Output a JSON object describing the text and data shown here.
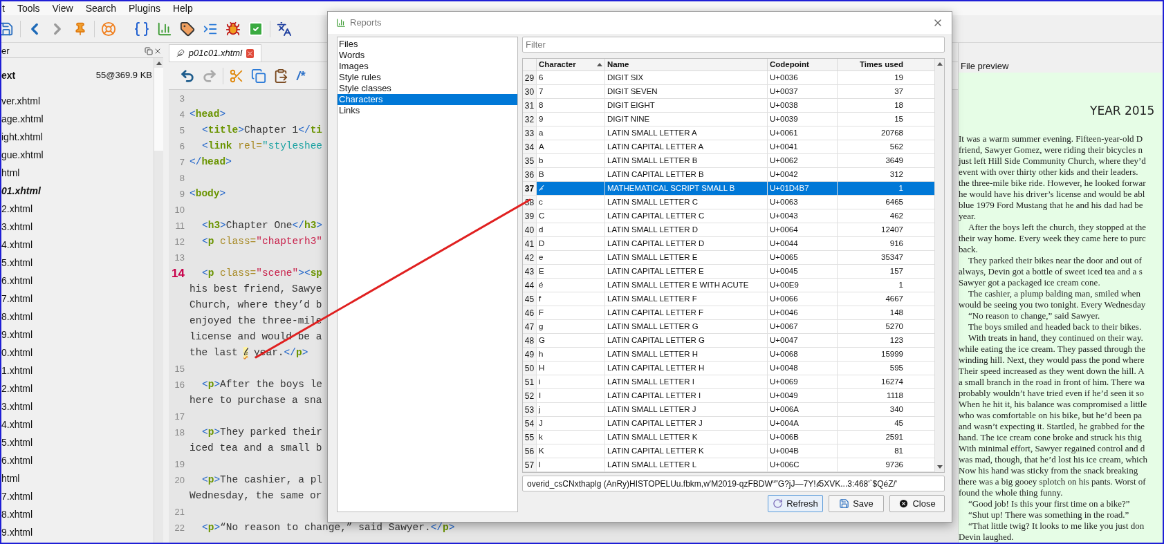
{
  "menu_bar": [
    "t",
    "Tools",
    "View",
    "Search",
    "Plugins",
    "Help"
  ],
  "book_browser": {
    "title": "er",
    "folder": {
      "name": "ext",
      "size": "55@369.9 KB"
    },
    "files": [
      {
        "name": "ver.xhtml",
        "open": false
      },
      {
        "name": "age.xhtml",
        "open": false
      },
      {
        "name": "ight.xhtml",
        "open": false
      },
      {
        "name": "gue.xhtml",
        "open": false
      },
      {
        "name": "html",
        "open": false
      },
      {
        "name": "01.xhtml",
        "open": true
      },
      {
        "name": "2.xhtml",
        "open": false
      },
      {
        "name": "3.xhtml",
        "open": false
      },
      {
        "name": "4.xhtml",
        "open": false
      },
      {
        "name": "5.xhtml",
        "open": false
      },
      {
        "name": "6.xhtml",
        "open": false
      },
      {
        "name": "7.xhtml",
        "open": false
      },
      {
        "name": "8.xhtml",
        "open": false
      },
      {
        "name": "9.xhtml",
        "open": false
      },
      {
        "name": "0.xhtml",
        "open": false
      },
      {
        "name": "1.xhtml",
        "open": false
      },
      {
        "name": "2.xhtml",
        "open": false
      },
      {
        "name": "3.xhtml",
        "open": false
      },
      {
        "name": "4.xhtml",
        "open": false
      },
      {
        "name": "5.xhtml",
        "open": false
      },
      {
        "name": "6.xhtml",
        "open": false
      },
      {
        "name": "html",
        "open": false
      },
      {
        "name": "7.xhtml",
        "open": false
      },
      {
        "name": "8.xhtml",
        "open": false
      },
      {
        "name": "9.xhtml",
        "open": false
      }
    ]
  },
  "editor": {
    "tab": {
      "label": "p01c01.xhtml",
      "selected": true
    },
    "comment_button": "/*",
    "code_lines": [
      {
        "number": "3",
        "current": false
      },
      {
        "number": "4",
        "current": false,
        "indent": false,
        "segments": [
          {
            "kind": "punct",
            "text": "<"
          },
          {
            "kind": "tag",
            "text": "head"
          },
          {
            "kind": "punct",
            "text": ">"
          }
        ]
      },
      {
        "number": "5",
        "current": false,
        "indent": true,
        "segments": [
          {
            "kind": "punct",
            "text": "<"
          },
          {
            "kind": "tag",
            "text": "title"
          },
          {
            "kind": "punct",
            "text": ">"
          },
          {
            "kind": "text",
            "text": "Chapter 1"
          },
          {
            "kind": "punct",
            "text": "</"
          },
          {
            "kind": "tag",
            "text": "ti"
          }
        ]
      },
      {
        "number": "6",
        "current": false,
        "indent": true,
        "segments": [
          {
            "kind": "punct",
            "text": "<"
          },
          {
            "kind": "tag",
            "text": "link"
          },
          {
            "kind": "attr",
            "text": " rel="
          },
          {
            "kind": "value-alt",
            "text": "\"styleshee"
          }
        ]
      },
      {
        "number": "7",
        "current": false,
        "indent": false,
        "segments": [
          {
            "kind": "punct",
            "text": "</"
          },
          {
            "kind": "tag",
            "text": "head"
          },
          {
            "kind": "punct",
            "text": ">"
          }
        ]
      },
      {
        "number": "8",
        "current": false
      },
      {
        "number": "9",
        "current": false,
        "indent": false,
        "segments": [
          {
            "kind": "punct",
            "text": "<"
          },
          {
            "kind": "tag",
            "text": "body"
          },
          {
            "kind": "punct",
            "text": ">"
          }
        ]
      },
      {
        "number": "10",
        "current": false
      },
      {
        "number": "11",
        "current": false,
        "indent": true,
        "segments": [
          {
            "kind": "punct",
            "text": "<"
          },
          {
            "kind": "tag",
            "text": "h3"
          },
          {
            "kind": "punct",
            "text": ">"
          },
          {
            "kind": "text",
            "text": "Chapter One"
          },
          {
            "kind": "punct",
            "text": "</"
          },
          {
            "kind": "tag",
            "text": "h3"
          },
          {
            "kind": "punct",
            "text": ">"
          }
        ]
      },
      {
        "number": "12",
        "current": false,
        "indent": true,
        "segments": [
          {
            "kind": "punct",
            "text": "<"
          },
          {
            "kind": "tag",
            "text": "p"
          },
          {
            "kind": "attr",
            "text": " class="
          },
          {
            "kind": "value",
            "text": "\"chapterh3\""
          }
        ]
      },
      {
        "number": "13",
        "current": false
      },
      {
        "number": "14",
        "current": true,
        "indent": true,
        "segments": [
          {
            "kind": "punct",
            "text": "<"
          },
          {
            "kind": "tag",
            "text": "p"
          },
          {
            "kind": "attr",
            "text": " class="
          },
          {
            "kind": "value",
            "text": "\"scene\""
          },
          {
            "kind": "punct",
            "text": "><"
          },
          {
            "kind": "tag",
            "text": "sp"
          }
        ],
        "wrapped": [
          [
            {
              "kind": "text",
              "text": "his best friend, Sawye"
            }
          ],
          [
            {
              "kind": "text",
              "text": "Church, where they’d b"
            }
          ],
          [
            {
              "kind": "text",
              "text": "enjoyed the three-mile"
            }
          ],
          [
            {
              "kind": "text",
              "text": "license and would be a"
            }
          ],
          [
            {
              "kind": "text",
              "text": "the last "
            },
            {
              "kind": "highlight",
              "text": "𝒷"
            },
            {
              "kind": "text",
              "text": " year."
            },
            {
              "kind": "punct",
              "text": "</"
            },
            {
              "kind": "tag",
              "text": "p"
            },
            {
              "kind": "punct",
              "text": ">"
            }
          ]
        ]
      },
      {
        "number": "15",
        "current": false
      },
      {
        "number": "16",
        "current": false,
        "indent": true,
        "segments": [
          {
            "kind": "punct",
            "text": "<"
          },
          {
            "kind": "tag",
            "text": "p"
          },
          {
            "kind": "punct",
            "text": ">"
          },
          {
            "kind": "text",
            "text": "After the boys le"
          }
        ],
        "wrapped": [
          [
            {
              "kind": "text",
              "text": "here to purchase a sna"
            }
          ]
        ]
      },
      {
        "number": "17",
        "current": false
      },
      {
        "number": "18",
        "current": false,
        "indent": true,
        "segments": [
          {
            "kind": "punct",
            "text": "<"
          },
          {
            "kind": "tag",
            "text": "p"
          },
          {
            "kind": "punct",
            "text": ">"
          },
          {
            "kind": "text",
            "text": "They parked their"
          }
        ],
        "wrapped": [
          [
            {
              "kind": "text",
              "text": "iced tea and a small b"
            }
          ]
        ]
      },
      {
        "number": "19",
        "current": false
      },
      {
        "number": "20",
        "current": false,
        "indent": true,
        "segments": [
          {
            "kind": "punct",
            "text": "<"
          },
          {
            "kind": "tag",
            "text": "p"
          },
          {
            "kind": "punct",
            "text": ">"
          },
          {
            "kind": "text",
            "text": "The cashier, a pl"
          }
        ],
        "wrapped": [
          [
            {
              "kind": "text",
              "text": "Wednesday, the same or"
            }
          ]
        ]
      },
      {
        "number": "21",
        "current": false
      },
      {
        "number": "22",
        "current": false,
        "indent": true,
        "segments": [
          {
            "kind": "punct",
            "text": "<"
          },
          {
            "kind": "tag",
            "text": "p"
          },
          {
            "kind": "punct",
            "text": ">"
          },
          {
            "kind": "text",
            "text": "“No reason to change,” said Sawyer."
          },
          {
            "kind": "punct",
            "text": "</"
          },
          {
            "kind": "tag",
            "text": "p"
          },
          {
            "kind": "punct",
            "text": ">"
          }
        ]
      }
    ]
  },
  "reports_dialog": {
    "title": "Reports",
    "sections": [
      {
        "label": "Files",
        "selected": false
      },
      {
        "label": "Words",
        "selected": false
      },
      {
        "label": "Images",
        "selected": false
      },
      {
        "label": "Style rules",
        "selected": false
      },
      {
        "label": "Style classes",
        "selected": false
      },
      {
        "label": "Characters",
        "selected": true
      },
      {
        "label": "Links",
        "selected": false
      }
    ],
    "filter": {
      "placeholder": "Filter"
    },
    "table": {
      "columns": [
        {
          "label": "Character",
          "sorted": true
        },
        {
          "label": "Name",
          "sorted": false
        },
        {
          "label": "Codepoint",
          "sorted": false
        },
        {
          "label": "Times used",
          "sorted": false
        }
      ],
      "rows": [
        {
          "index": "29",
          "character": "6",
          "name": "DIGIT SIX",
          "codepoint": "U+0036",
          "times_used": "19",
          "selected": false
        },
        {
          "index": "30",
          "character": "7",
          "name": "DIGIT SEVEN",
          "codepoint": "U+0037",
          "times_used": "37",
          "selected": false
        },
        {
          "index": "31",
          "character": "8",
          "name": "DIGIT EIGHT",
          "codepoint": "U+0038",
          "times_used": "18",
          "selected": false
        },
        {
          "index": "32",
          "character": "9",
          "name": "DIGIT NINE",
          "codepoint": "U+0039",
          "times_used": "15",
          "selected": false
        },
        {
          "index": "33",
          "character": "a",
          "name": "LATIN SMALL LETTER A",
          "codepoint": "U+0061",
          "times_used": "20768",
          "selected": false
        },
        {
          "index": "34",
          "character": "A",
          "name": "LATIN CAPITAL LETTER A",
          "codepoint": "U+0041",
          "times_used": "562",
          "selected": false
        },
        {
          "index": "35",
          "character": "b",
          "name": "LATIN SMALL LETTER B",
          "codepoint": "U+0062",
          "times_used": "3649",
          "selected": false
        },
        {
          "index": "36",
          "character": "B",
          "name": "LATIN CAPITAL LETTER B",
          "codepoint": "U+0042",
          "times_used": "312",
          "selected": false
        },
        {
          "index": "37",
          "character": "𝒷",
          "name": "MATHEMATICAL SCRIPT SMALL B",
          "codepoint": "U+01D4B7",
          "times_used": "1",
          "selected": true
        },
        {
          "index": "38",
          "character": "c",
          "name": "LATIN SMALL LETTER C",
          "codepoint": "U+0063",
          "times_used": "6465",
          "selected": false
        },
        {
          "index": "39",
          "character": "C",
          "name": "LATIN CAPITAL LETTER C",
          "codepoint": "U+0043",
          "times_used": "462",
          "selected": false
        },
        {
          "index": "40",
          "character": "d",
          "name": "LATIN SMALL LETTER D",
          "codepoint": "U+0064",
          "times_used": "12407",
          "selected": false
        },
        {
          "index": "41",
          "character": "D",
          "name": "LATIN CAPITAL LETTER D",
          "codepoint": "U+0044",
          "times_used": "916",
          "selected": false
        },
        {
          "index": "42",
          "character": "e",
          "name": "LATIN SMALL LETTER E",
          "codepoint": "U+0065",
          "times_used": "35347",
          "selected": false
        },
        {
          "index": "43",
          "character": "E",
          "name": "LATIN CAPITAL LETTER E",
          "codepoint": "U+0045",
          "times_used": "157",
          "selected": false
        },
        {
          "index": "44",
          "character": "é",
          "name": "LATIN SMALL LETTER E WITH ACUTE",
          "codepoint": "U+00E9",
          "times_used": "1",
          "selected": false
        },
        {
          "index": "45",
          "character": "f",
          "name": "LATIN SMALL LETTER F",
          "codepoint": "U+0066",
          "times_used": "4667",
          "selected": false
        },
        {
          "index": "46",
          "character": "F",
          "name": "LATIN CAPITAL LETTER F",
          "codepoint": "U+0046",
          "times_used": "148",
          "selected": false
        },
        {
          "index": "47",
          "character": "g",
          "name": "LATIN SMALL LETTER G",
          "codepoint": "U+0067",
          "times_used": "5270",
          "selected": false
        },
        {
          "index": "48",
          "character": "G",
          "name": "LATIN CAPITAL LETTER G",
          "codepoint": "U+0047",
          "times_used": "123",
          "selected": false
        },
        {
          "index": "49",
          "character": "h",
          "name": "LATIN SMALL LETTER H",
          "codepoint": "U+0068",
          "times_used": "15999",
          "selected": false
        },
        {
          "index": "50",
          "character": "H",
          "name": "LATIN CAPITAL LETTER H",
          "codepoint": "U+0048",
          "times_used": "595",
          "selected": false
        },
        {
          "index": "51",
          "character": "i",
          "name": "LATIN SMALL LETTER I",
          "codepoint": "U+0069",
          "times_used": "16274",
          "selected": false
        },
        {
          "index": "52",
          "character": "I",
          "name": "LATIN CAPITAL LETTER I",
          "codepoint": "U+0049",
          "times_used": "1118",
          "selected": false
        },
        {
          "index": "53",
          "character": "j",
          "name": "LATIN SMALL LETTER J",
          "codepoint": "U+006A",
          "times_used": "340",
          "selected": false
        },
        {
          "index": "54",
          "character": "J",
          "name": "LATIN CAPITAL LETTER J",
          "codepoint": "U+004A",
          "times_used": "45",
          "selected": false
        },
        {
          "index": "55",
          "character": "k",
          "name": "LATIN SMALL LETTER K",
          "codepoint": "U+006B",
          "times_used": "2591",
          "selected": false
        },
        {
          "index": "56",
          "character": "K",
          "name": "LATIN CAPITAL LETTER K",
          "codepoint": "U+004B",
          "times_used": "81",
          "selected": false
        },
        {
          "index": "57",
          "character": "l",
          "name": "LATIN SMALL LETTER L",
          "codepoint": "U+006C",
          "times_used": "9736",
          "selected": false
        }
      ]
    },
    "detail_field": {
      "value": "overid_csCNxthaplg (AnRy)HISTOPELUu.fbkm,w'M2019-qzFBDW“”G?jJ—7Y!𝒷5XVK...3:468'`$QéZ/'"
    },
    "buttons": [
      {
        "kind": "refresh",
        "label": "Refresh"
      },
      {
        "kind": "save",
        "label": "Save"
      },
      {
        "kind": "close",
        "label": "Close"
      }
    ]
  },
  "file_preview": {
    "title": "File preview",
    "heading": "YEAR 2015",
    "lines": [
      {
        "text": "It was a warm summer evening. Fifteen-year-old D",
        "indent": false
      },
      {
        "text": "friend, Sawyer Gomez, were riding their bicycles n",
        "indent": false
      },
      {
        "text": "just left Hill Side Community Church, where they’d",
        "indent": false
      },
      {
        "text": "event with over thirty other kids and their leaders.",
        "indent": false
      },
      {
        "text": "the three-mile bike ride. However, he looked forwar",
        "indent": false
      },
      {
        "text": "he would have his driver’s license and would be abl",
        "indent": false
      },
      {
        "text": "blue 1979 Ford Mustang that he and his dad had be",
        "indent": false
      },
      {
        "text": "year.",
        "indent": false
      },
      {
        "text": "After the boys left the church, they stopped at the",
        "indent": true
      },
      {
        "text": "their way home. Every week they came here to purc",
        "indent": false
      },
      {
        "text": "back.",
        "indent": false
      },
      {
        "text": "They parked their bikes near the door and out of",
        "indent": true
      },
      {
        "text": "always, Devin got a bottle of sweet iced tea and a s",
        "indent": false
      },
      {
        "text": "Sawyer got a packaged ice cream cone.",
        "indent": false
      },
      {
        "text": "The cashier, a plump balding man, smiled when",
        "indent": true
      },
      {
        "text": "would be seeing you two tonight. Every Wednesday",
        "indent": false
      },
      {
        "text": "“No reason to change,” said Sawyer.",
        "indent": true
      },
      {
        "text": "The boys smiled and headed back to their bikes.",
        "indent": true
      },
      {
        "text": "With treats in hand, they continued on their way.",
        "indent": true
      },
      {
        "text": "while eating the ice cream. They passed through the",
        "indent": false
      },
      {
        "text": "winding hill. Next, they would pass the pond where",
        "indent": false
      },
      {
        "text": "Their speed increased as they went down the hill. A",
        "indent": false
      },
      {
        "text": "a small branch in the road in front of him. There wa",
        "indent": false
      },
      {
        "text": "probably wouldn’t have tried even if he’d seen it so",
        "indent": false
      },
      {
        "text": "When he hit it, his balance was compromised a little",
        "indent": false
      },
      {
        "text": "who was comfortable on his bike, but he’d been pa",
        "indent": false
      },
      {
        "text": "and wasn’t expecting it. Startled, he grabbed for the",
        "indent": false
      },
      {
        "text": "hand. The ice cream cone broke and struck his thig",
        "indent": false
      },
      {
        "text": "With minimal effort, Sawyer regained control and d",
        "indent": false
      },
      {
        "text": "was mad, though, that he’d lost his ice cream, which",
        "indent": false
      },
      {
        "text": "Now his hand was sticky from the snack breaking",
        "indent": false
      },
      {
        "text": "there was a big gooey splotch on his pants. Worst of",
        "indent": false
      },
      {
        "text": "found the whole thing funny.",
        "indent": false
      },
      {
        "text": "“Good job! Is this your first time on a bike?”",
        "indent": true
      },
      {
        "text": "“Shut up! There was something in the road.”",
        "indent": true
      },
      {
        "text": "“That little twig? It looks to me like you just don",
        "indent": true
      },
      {
        "text": "Devin laughed.",
        "indent": false
      }
    ]
  }
}
